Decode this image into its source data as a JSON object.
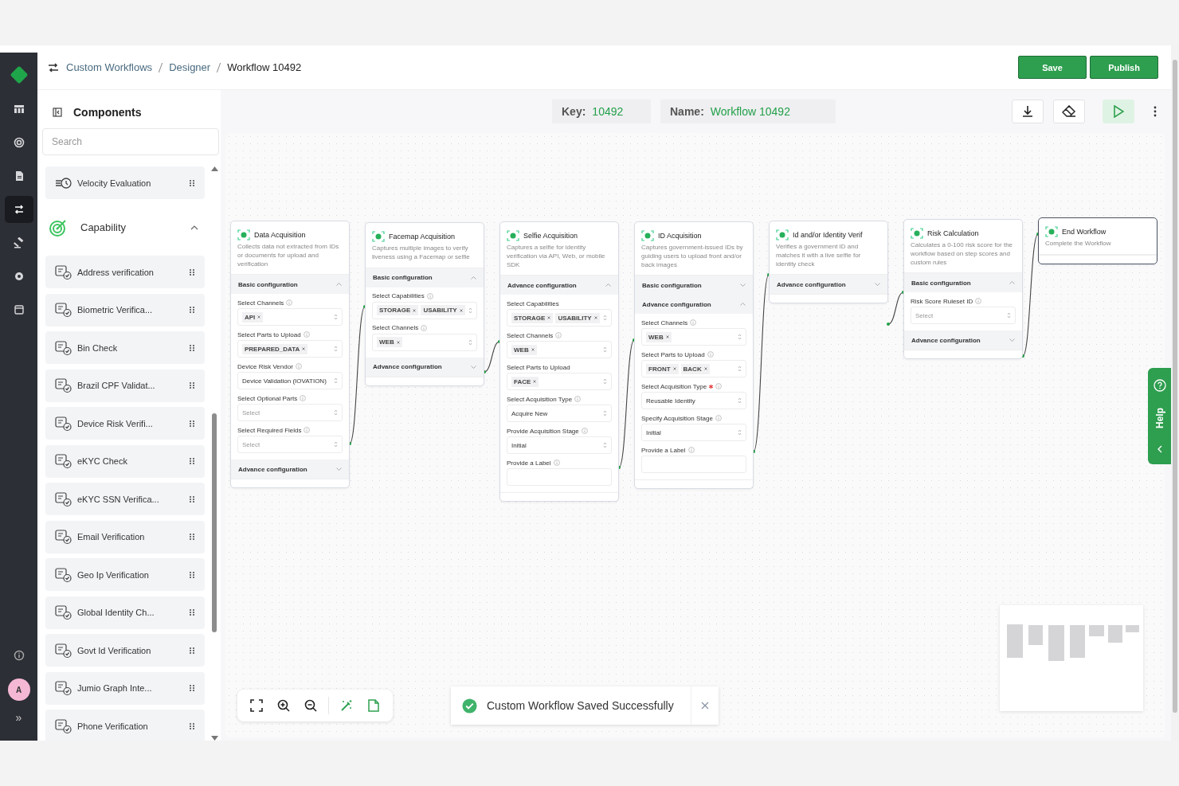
{
  "breadcrumb": [
    "Custom Workflows",
    "Designer",
    "Workflow 10492"
  ],
  "actions": [
    "Save",
    "Publish"
  ],
  "rail": {
    "items": [
      {
        "selected": false
      },
      {
        "selected": false
      },
      {
        "selected": false
      },
      {
        "selected": true
      },
      {
        "selected": false
      },
      {
        "selected": false
      },
      {
        "selected": false
      }
    ],
    "avatar": "A",
    "expand": "»"
  },
  "components": {
    "title": "Components",
    "search": {
      "placeholder": "Search"
    },
    "items": [
      {
        "label": "Velocity Evaluation"
      }
    ],
    "groups": [
      {
        "title": "Capability",
        "expanded": true,
        "items": [
          {
            "label": "Address verification"
          },
          {
            "label": "Biometric Verifica..."
          },
          {
            "label": "Bin Check"
          },
          {
            "label": "Brazil CPF Validat..."
          },
          {
            "label": "Device Risk Verifi..."
          },
          {
            "label": "eKYC Check"
          },
          {
            "label": "eKYC SSN Verifica..."
          },
          {
            "label": "Email Verification"
          },
          {
            "label": "Geo Ip Verification"
          },
          {
            "label": "Global Identity Ch..."
          },
          {
            "label": "Govt Id Verification"
          },
          {
            "label": "Jumio Graph Inte..."
          },
          {
            "label": "Phone Verification"
          }
        ]
      }
    ]
  },
  "workflow": {
    "key_label": "Key:",
    "key": "10492",
    "name_label": "Name:",
    "name": "Workflow 10492"
  },
  "nodes": [
    {
      "title": "Data Acquisition",
      "description": "Collects data not extracted from IDs or documents for upload and verification",
      "selected": false,
      "sections": [
        {
          "title": "Basic configuration",
          "expanded": true,
          "fields": [
            {
              "kind": "select",
              "label": "Select Channels",
              "info": true,
              "required": false,
              "chips": [
                "API"
              ]
            },
            {
              "kind": "select",
              "label": "Select Parts to Upload",
              "info": true,
              "required": false,
              "chips": [
                "PREPARED_DATA"
              ]
            },
            {
              "kind": "select",
              "label": "Device Risk Vendor",
              "info": true,
              "required": false,
              "value": "Device Validation (IOVATION)"
            },
            {
              "kind": "select",
              "label": "Select Optional Parts",
              "info": true,
              "required": false,
              "placeholder": "Select"
            },
            {
              "kind": "select",
              "label": "Select Required Fields",
              "info": true,
              "required": false,
              "placeholder": "Select"
            }
          ]
        },
        {
          "title": "Advance configuration",
          "expanded": false
        }
      ]
    },
    {
      "title": "Facemap Acquisition",
      "description": "Captures multiple images to verify liveness using a Facemap or selfie",
      "selected": false,
      "sections": [
        {
          "title": "Basic configuration",
          "expanded": true,
          "fields": [
            {
              "kind": "select",
              "label": "Select Capabilities",
              "info": true,
              "required": false,
              "chips": [
                "STORAGE",
                "USABILITY"
              ]
            },
            {
              "kind": "select",
              "label": "Select Channels",
              "info": true,
              "required": false,
              "chips": [
                "WEB"
              ]
            }
          ]
        },
        {
          "title": "Advance configuration",
          "expanded": false
        }
      ]
    },
    {
      "title": "Selfie Acquisition",
      "description": "Captures a selfie for identity verification via API, Web, or mobile SDK",
      "selected": false,
      "sections": [
        {
          "title": "Advance configuration",
          "expanded": true,
          "fields": [
            {
              "kind": "select",
              "label": "Select Capabilities",
              "info": false,
              "required": false,
              "chips": [
                "STORAGE",
                "USABILITY"
              ]
            },
            {
              "kind": "select",
              "label": "Select Channels",
              "info": true,
              "required": false,
              "chips": [
                "WEB"
              ]
            },
            {
              "kind": "select",
              "label": "Select Parts to Upload",
              "info": false,
              "required": false,
              "chips": [
                "FACE"
              ]
            },
            {
              "kind": "select",
              "label": "Select Acquisition Type",
              "info": true,
              "required": false,
              "value": "Acquire New"
            },
            {
              "kind": "select",
              "label": "Provide Acquisition Stage",
              "info": true,
              "required": false,
              "value": "Initial"
            },
            {
              "kind": "text",
              "label": "Provide a Label",
              "info": true,
              "required": false
            }
          ]
        }
      ]
    },
    {
      "title": "ID Acquisition",
      "description": "Captures government-issued IDs by guiding users to upload front and/or back images",
      "selected": false,
      "sections": [
        {
          "title": "Basic configuration",
          "expanded": false
        },
        {
          "title": "Advance configuration",
          "expanded": true,
          "fields": [
            {
              "kind": "select",
              "label": "Select Channels",
              "info": true,
              "required": false,
              "chips": [
                "WEB"
              ]
            },
            {
              "kind": "select",
              "label": "Select Parts to Upload",
              "info": true,
              "required": false,
              "chips": [
                "FRONT",
                "BACK"
              ]
            },
            {
              "kind": "select",
              "label": "Select Acquisition Type",
              "info": true,
              "required": true,
              "value": "Reusable Identity"
            },
            {
              "kind": "select",
              "label": "Specify Acquisition Stage",
              "info": true,
              "required": false,
              "value": "Initial"
            },
            {
              "kind": "text",
              "label": "Provide a Label",
              "info": true,
              "required": false
            }
          ]
        }
      ]
    },
    {
      "title": "Id and/or Identity Verif",
      "description": "Verifies a government ID and matches it with a live selfie for identity check",
      "selected": false,
      "sections": [
        {
          "title": "Advance configuration",
          "expanded": false
        }
      ]
    },
    {
      "title": "Risk Calculation",
      "description": "Calculates a 0-100 risk score for the workflow based on step scores and custom rules",
      "selected": false,
      "sections": [
        {
          "title": "Basic configuration",
          "expanded": true,
          "fields": [
            {
              "kind": "select",
              "label": "Risk Score Ruleset ID",
              "info": true,
              "required": false,
              "placeholder": "Select"
            }
          ]
        },
        {
          "title": "Advance configuration",
          "expanded": false
        }
      ]
    },
    {
      "title": "End Workflow",
      "description": "Complete the Workflow",
      "selected": true
    }
  ],
  "toast": {
    "message": "Custom Workflow Saved Successfully"
  },
  "help": {
    "label": "Help"
  }
}
